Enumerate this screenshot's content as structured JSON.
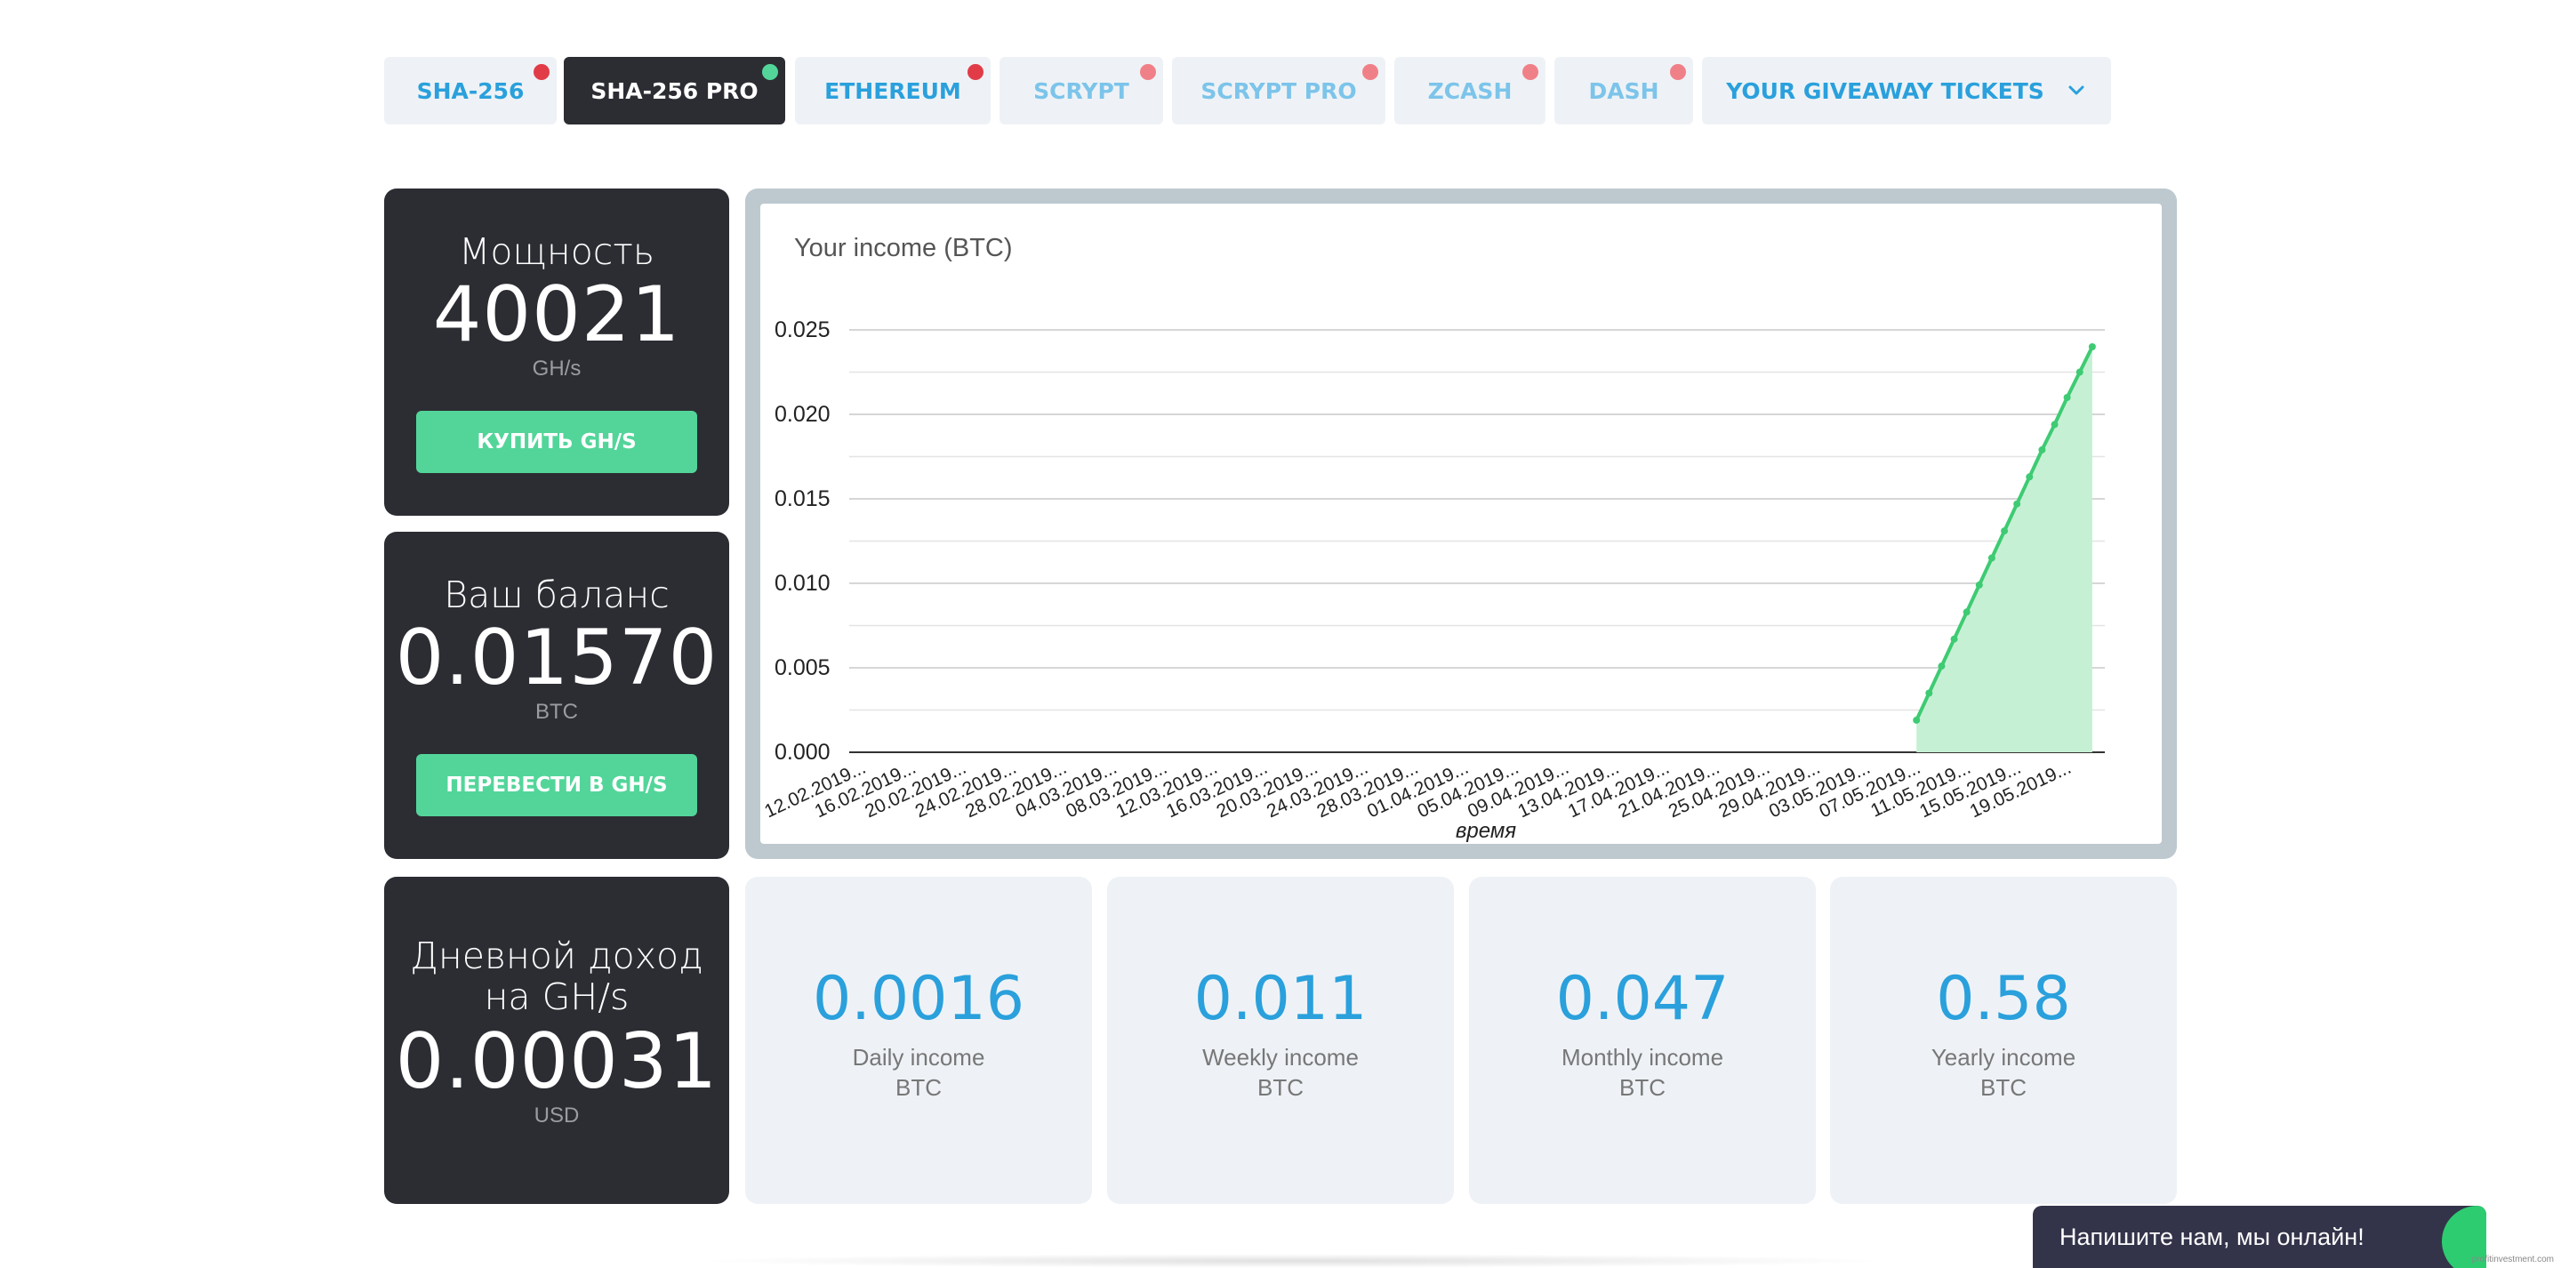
{
  "tabs": [
    {
      "label": "SHA-256",
      "state": "normal",
      "dot": "red"
    },
    {
      "label": "SHA-256 PRO",
      "state": "active",
      "dot": "green"
    },
    {
      "label": "ETHEREUM",
      "state": "normal",
      "dot": "red"
    },
    {
      "label": "SCRYPT",
      "state": "light",
      "dot": "pink"
    },
    {
      "label": "SCRYPT PRO",
      "state": "light",
      "dot": "pink"
    },
    {
      "label": "ZCASH",
      "state": "light",
      "dot": "pink"
    },
    {
      "label": "DASH",
      "state": "light",
      "dot": "pink"
    },
    {
      "label": "YOUR GIVEAWAY TICKETS",
      "state": "dropdown",
      "icon": "chevron-down-icon"
    }
  ],
  "power": {
    "label": "Мощность",
    "value": "40021",
    "unit": "GH/s",
    "button": "КУПИТЬ GH/S"
  },
  "balance": {
    "label": "Ваш баланс",
    "value": "0.01570",
    "unit": "BTC",
    "button": "ПЕРЕВЕСТИ В GH/S"
  },
  "daily_per_ghs": {
    "label_line1": "Дневной доход",
    "label_line2": "на GH/s",
    "value": "0.00031",
    "unit": "USD"
  },
  "stats": [
    {
      "value": "0.0016",
      "label": "Daily income",
      "unit": "BTC"
    },
    {
      "value": "0.011",
      "label": "Weekly income",
      "unit": "BTC"
    },
    {
      "value": "0.047",
      "label": "Monthly income",
      "unit": "BTC"
    },
    {
      "value": "0.58",
      "label": "Yearly income",
      "unit": "BTC"
    }
  ],
  "chat": {
    "text": "Напишите нам, мы онлайн!"
  },
  "watermark": "profitinvestment.com",
  "colors": {
    "accent": "#2aa0dc",
    "green": "#53d59a",
    "dark": "#2c2d33",
    "red_dot": "#e23b48"
  },
  "chart_data": {
    "type": "area",
    "title": "Your income (BTC)",
    "xlabel": "время",
    "ylabel": "",
    "ylim": [
      0,
      0.025
    ],
    "yticks": [
      "0.000",
      "0.005",
      "0.010",
      "0.015",
      "0.020",
      "0.025"
    ],
    "xtick_labels": [
      "12.02.2019...",
      "16.02.2019...",
      "20.02.2019...",
      "24.02.2019...",
      "28.02.2019...",
      "04.03.2019...",
      "08.03.2019...",
      "12.03.2019...",
      "16.03.2019...",
      "20.03.2019...",
      "24.03.2019...",
      "28.03.2019...",
      "01.04.2019...",
      "05.04.2019...",
      "09.04.2019...",
      "13.04.2019...",
      "17.04.2019...",
      "21.04.2019...",
      "25.04.2019...",
      "29.04.2019...",
      "03.05.2019...",
      "07.05.2019...",
      "11.05.2019...",
      "15.05.2019...",
      "19.05.2019..."
    ],
    "x_start": "2019-02-12",
    "x_end": "2019-05-23",
    "series": [
      {
        "values": [
          {
            "date": "2019-05-08",
            "y": 0.0019
          },
          {
            "date": "2019-05-09",
            "y": 0.0035
          },
          {
            "date": "2019-05-10",
            "y": 0.0051
          },
          {
            "date": "2019-05-11",
            "y": 0.0067
          },
          {
            "date": "2019-05-12",
            "y": 0.0083
          },
          {
            "date": "2019-05-13",
            "y": 0.0099
          },
          {
            "date": "2019-05-14",
            "y": 0.0115
          },
          {
            "date": "2019-05-15",
            "y": 0.0131
          },
          {
            "date": "2019-05-16",
            "y": 0.0147
          },
          {
            "date": "2019-05-17",
            "y": 0.0163
          },
          {
            "date": "2019-05-18",
            "y": 0.0179
          },
          {
            "date": "2019-05-19",
            "y": 0.0194
          },
          {
            "date": "2019-05-20",
            "y": 0.021
          },
          {
            "date": "2019-05-21",
            "y": 0.0225
          },
          {
            "date": "2019-05-22",
            "y": 0.024
          }
        ]
      }
    ],
    "grid": true,
    "legend": "none"
  }
}
